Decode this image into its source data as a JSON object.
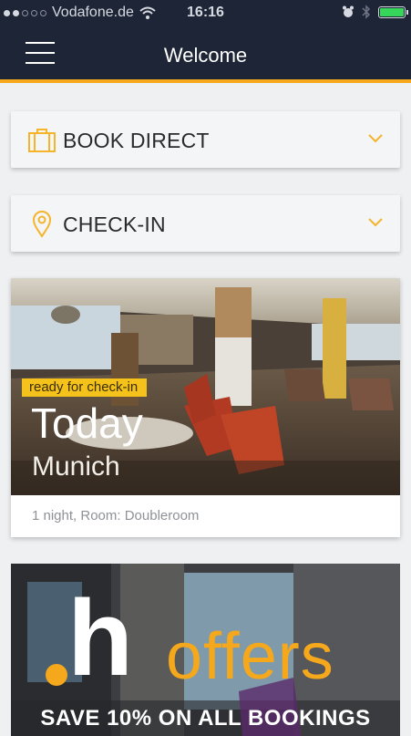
{
  "status_bar": {
    "carrier": "Vodafone.de",
    "time": "16:16"
  },
  "nav": {
    "title": "Welcome"
  },
  "actions": {
    "book_direct": "BOOK DIRECT",
    "check_in": "CHECK-IN"
  },
  "hotel_card": {
    "badge": "ready for check-in",
    "when": "Today",
    "city": "Munich",
    "details": "1 night, Room: Doubleroom"
  },
  "offers": {
    "logo_letter": "h",
    "word": "offers",
    "subtitle": "SAVE 10% ON ALL BOOKINGS"
  },
  "colors": {
    "nav_bg": "#1d2536",
    "accent": "#f5a81c",
    "badge": "#f5c21c"
  }
}
